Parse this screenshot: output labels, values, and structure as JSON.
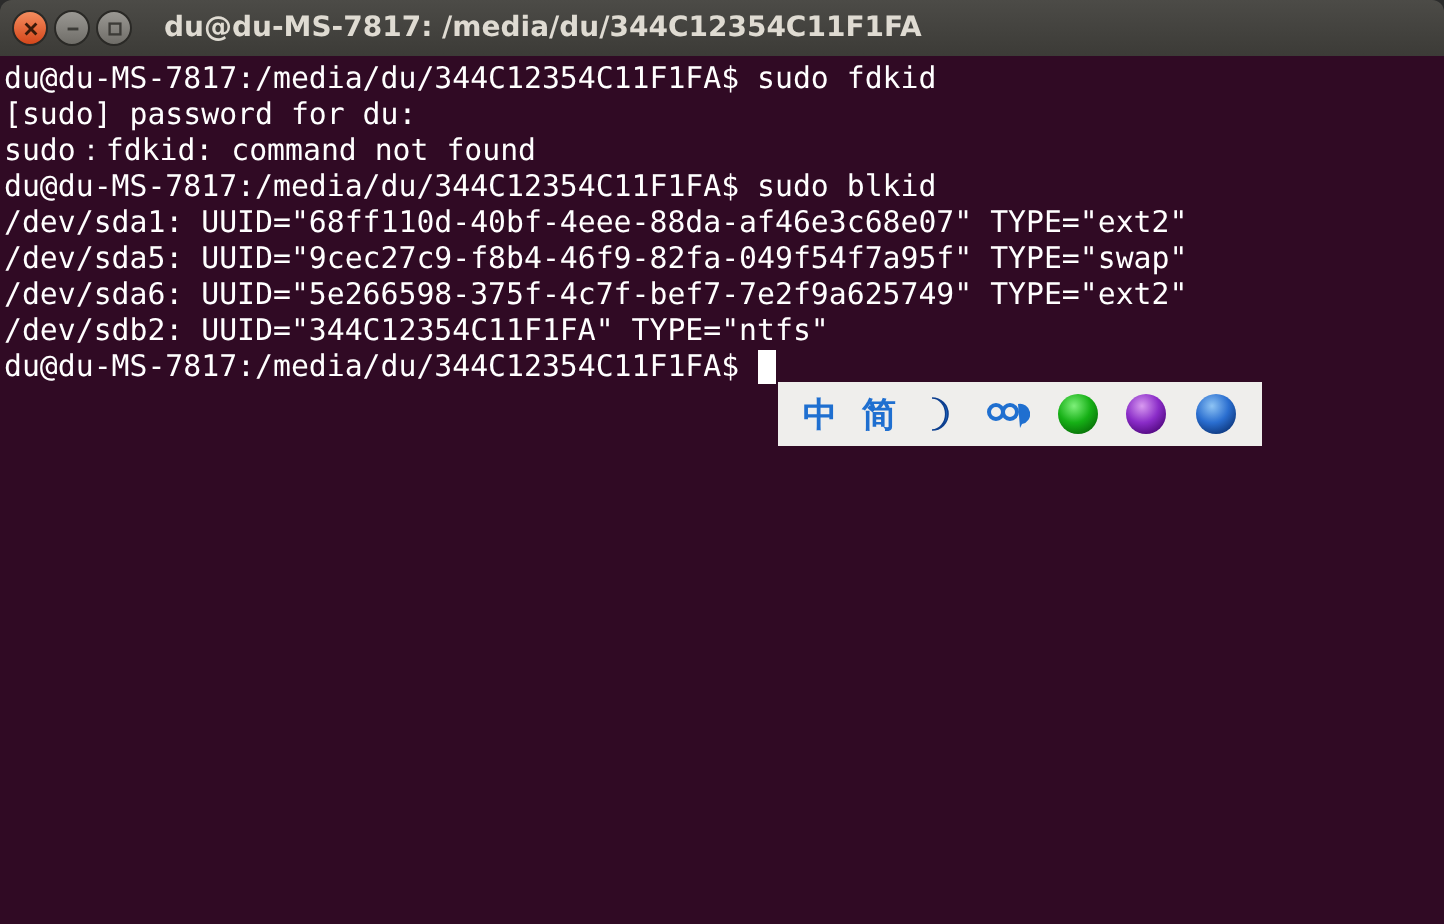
{
  "window": {
    "title": "du@du-MS-7817: /media/du/344C12354C11F1FA"
  },
  "terminal": {
    "lines": [
      "du@du-MS-7817:/media/du/344C12354C11F1FA$ sudo fdkid",
      "[sudo] password for du:",
      "sudo：fdkid: command not found",
      "du@du-MS-7817:/media/du/344C12354C11F1FA$ sudo blkid",
      "/dev/sda1: UUID=\"68ff110d-40bf-4eee-88da-af46e3c68e07\" TYPE=\"ext2\"",
      "/dev/sda5: UUID=\"9cec27c9-f8b4-46f9-82fa-049f54f7a95f\" TYPE=\"swap\"",
      "/dev/sda6: UUID=\"5e266598-375f-4c7f-bef7-7e2f9a625749\" TYPE=\"ext2\"",
      "/dev/sdb2: UUID=\"344C12354C11F1FA\" TYPE=\"ntfs\""
    ],
    "prompt": "du@du-MS-7817:/media/du/344C12354C11F1FA$"
  },
  "ime_toolbar": {
    "chinese_mode": "中",
    "simplified_mode": "简"
  }
}
